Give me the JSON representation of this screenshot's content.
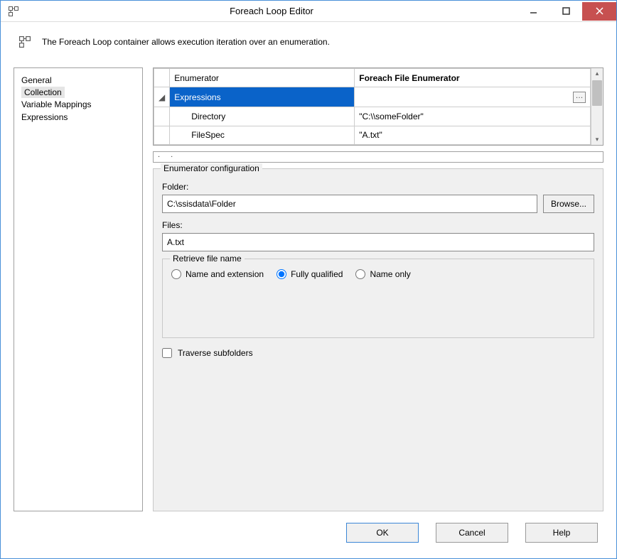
{
  "titlebar": {
    "title": "Foreach Loop Editor"
  },
  "info": {
    "text": "The Foreach Loop container allows execution iteration over an enumeration."
  },
  "nav": {
    "items": [
      "General",
      "Collection",
      "Variable Mappings",
      "Expressions"
    ],
    "selected_index": 1
  },
  "grid": {
    "rows": [
      {
        "col1": "",
        "label": "Enumerator",
        "value": "Foreach File Enumerator",
        "bold": true,
        "indent": 0,
        "selected": false,
        "ellipsis": false
      },
      {
        "col1": "◢",
        "label": "Expressions",
        "value": "",
        "bold": false,
        "indent": 0,
        "selected": true,
        "ellipsis": true
      },
      {
        "col1": "",
        "label": "Directory",
        "value": "\"C:\\\\someFolder\"",
        "bold": false,
        "indent": 1,
        "selected": false,
        "ellipsis": false
      },
      {
        "col1": "",
        "label": "FileSpec",
        "value": "\"A.txt\"",
        "bold": false,
        "indent": 1,
        "selected": false,
        "ellipsis": false
      }
    ]
  },
  "config": {
    "legend": "Enumerator configuration",
    "folder_label": "Folder:",
    "folder_value": "C:\\ssisdata\\Folder",
    "browse_label": "Browse...",
    "files_label": "Files:",
    "files_value": "A.txt",
    "retrieve": {
      "legend": "Retrieve file name",
      "options": [
        "Name and extension",
        "Fully qualified",
        "Name only"
      ],
      "selected_index": 1
    },
    "traverse_label": "Traverse subfolders",
    "traverse_checked": false
  },
  "buttons": {
    "ok": "OK",
    "cancel": "Cancel",
    "help": "Help"
  }
}
